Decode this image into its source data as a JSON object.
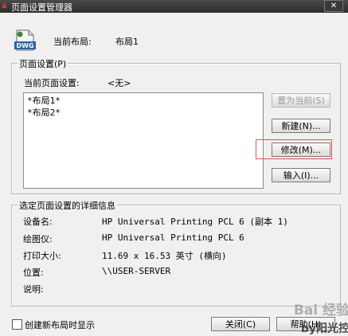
{
  "window": {
    "title": "页面设置管理器",
    "close_glyph": "✕"
  },
  "current_layout": {
    "label": "当前布局:",
    "value": "布局1",
    "icon_text": "DWG"
  },
  "page_setup": {
    "group_title": "页面设置(P)",
    "current_label": "当前页面设置:",
    "current_value": "<无>",
    "items": [
      "*布局1*",
      "*布局2*"
    ]
  },
  "buttons": {
    "set_current": "置为当前(S)",
    "new": "新建(N)...",
    "modify": "修改(M)...",
    "import": "输入(I)..."
  },
  "details": {
    "group_title": "选定页面设置的详细信息",
    "rows": [
      {
        "label": "设备名:",
        "value": "HP Universal Printing PCL 6 (副本 1)"
      },
      {
        "label": "绘图仪:",
        "value": "HP Universal Printing PCL 6"
      },
      {
        "label": "打印大小:",
        "value": "11.69 x 16.53 英寸 (横向)"
      },
      {
        "label": "位置:",
        "value": "\\\\USER-SERVER"
      },
      {
        "label": "说明:",
        "value": ""
      }
    ]
  },
  "footer": {
    "checkbox_label": "创建新布局时显示",
    "close_button": "关闭(C)",
    "help_button": "帮助(H)"
  },
  "colors": {
    "highlight": "#d9534f",
    "titlebar": "#2c2c2c"
  },
  "watermark": {
    "text": "Bai 经验",
    "subtext": "by阳光控"
  }
}
